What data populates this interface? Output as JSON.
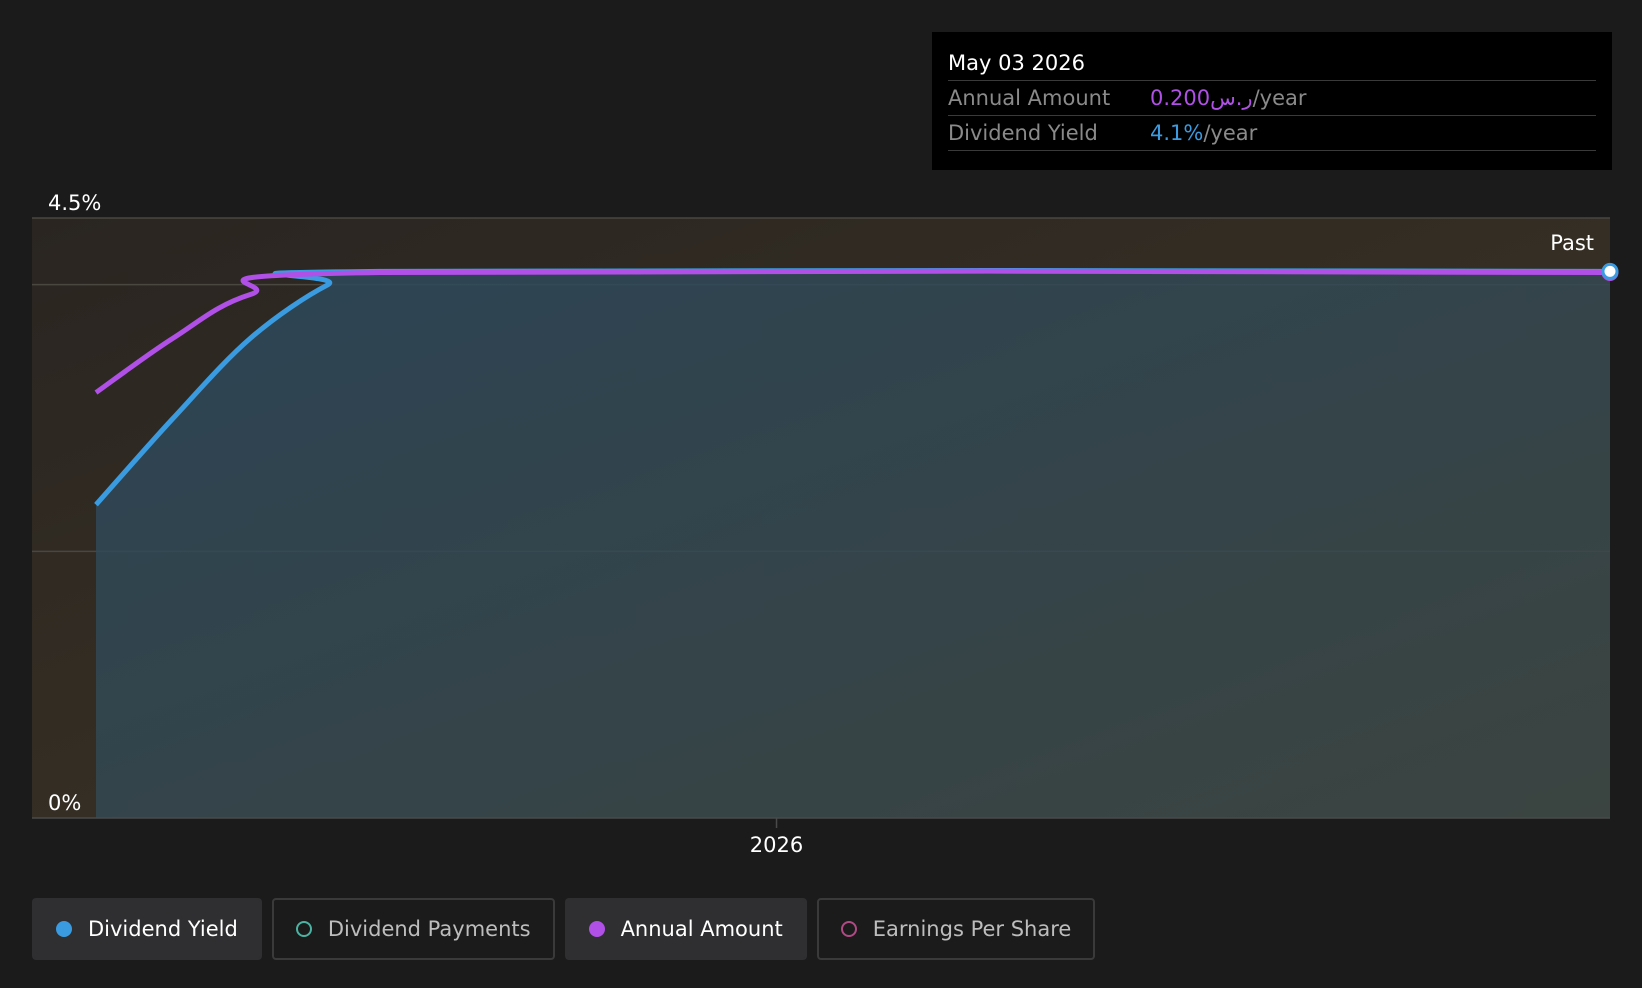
{
  "chart_data": {
    "type": "area",
    "x_axis": {
      "ticks": [
        {
          "label": "2026",
          "x": "2026-01-01"
        }
      ]
    },
    "y_axis": {
      "ticks": [
        "4.5%",
        "0%"
      ],
      "ylim": [
        0,
        4.5
      ],
      "unit": "%"
    },
    "x_range": [
      "2024-12-01",
      "2027-05-01"
    ],
    "series": [
      {
        "name": "Dividend Yield",
        "color": "#3a9be0",
        "unit": "%",
        "points": [
          [
            "2024-12-01",
            2.35
          ],
          [
            "2025-01-15",
            3.0
          ],
          [
            "2025-03-01",
            3.6
          ],
          [
            "2025-04-15",
            4.0
          ],
          [
            "2025-05-15",
            4.1
          ],
          [
            "2027-05-01",
            4.1
          ]
        ]
      },
      {
        "name": "Annual Amount",
        "color": "#b050e6",
        "unit": "ر.س",
        "points": [
          [
            "2024-12-01",
            0.156
          ],
          [
            "2025-01-15",
            0.176
          ],
          [
            "2025-03-01",
            0.192
          ],
          [
            "2025-05-15",
            0.2
          ],
          [
            "2027-05-01",
            0.2
          ]
        ],
        "ylim": [
          0,
          0.22
        ]
      }
    ],
    "annotations": [
      {
        "text": "Past"
      }
    ],
    "grid": true,
    "highlighted_date": "2026-05-03"
  },
  "tooltip": {
    "date": "May 03 2026",
    "rows": [
      {
        "label": "Annual Amount",
        "value": "0.200ر.س",
        "unit": "/year",
        "color": "#b050e6"
      },
      {
        "label": "Dividend Yield",
        "value": "4.1%",
        "unit": "/year",
        "color": "#3a9be0"
      }
    ]
  },
  "legend": [
    {
      "label": "Dividend Yield",
      "color": "#3a9be0",
      "active": true
    },
    {
      "label": "Dividend Payments",
      "color": "#4bb3a3",
      "active": false
    },
    {
      "label": "Annual Amount",
      "color": "#b050e6",
      "active": true
    },
    {
      "label": "Earnings Per Share",
      "color": "#b04a84",
      "active": false
    }
  ]
}
